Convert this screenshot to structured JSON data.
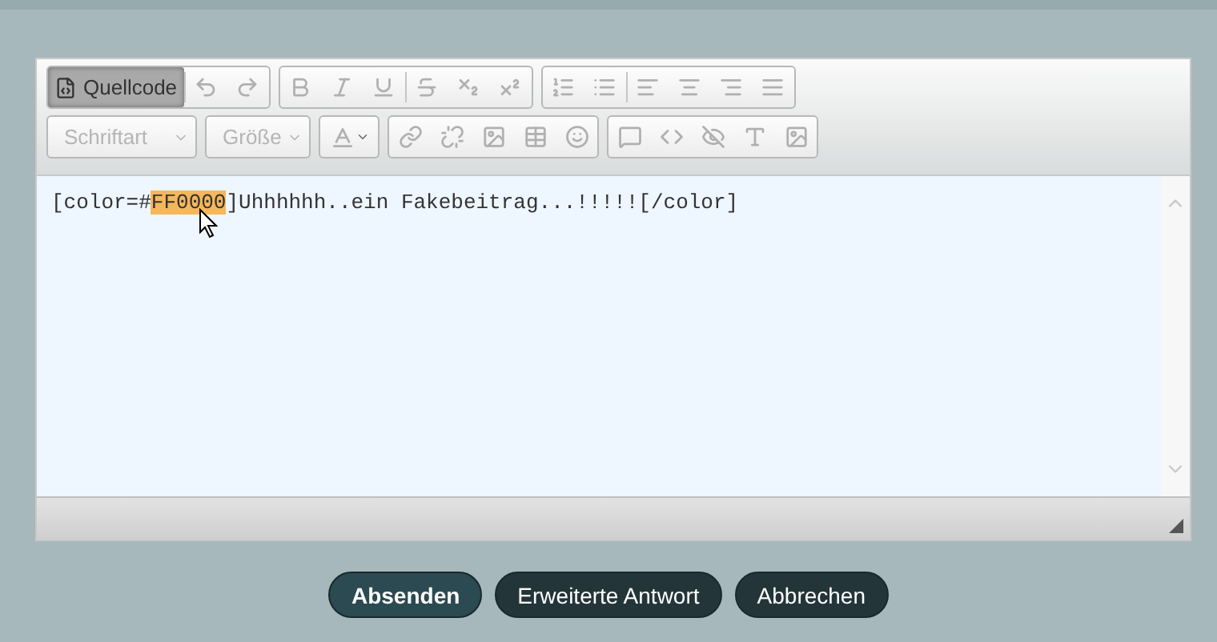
{
  "toolbar": {
    "source_button": {
      "label": "Quellcode",
      "selected": true
    },
    "font_dropdown": {
      "label": "Schriftart"
    },
    "size_dropdown": {
      "label": "Größe"
    }
  },
  "editor": {
    "content": [
      {
        "text": "[color=#",
        "highlighted": false
      },
      {
        "text": "FF0000",
        "highlighted": true
      },
      {
        "text": "]Uhhhhhh..ein Fakebeitrag...!!!!![/color]",
        "highlighted": false
      }
    ]
  },
  "buttons": [
    {
      "label": "Absenden",
      "primary": true
    },
    {
      "label": "Erweiterte Antwort",
      "primary": false
    },
    {
      "label": "Abbrechen",
      "primary": false
    }
  ]
}
